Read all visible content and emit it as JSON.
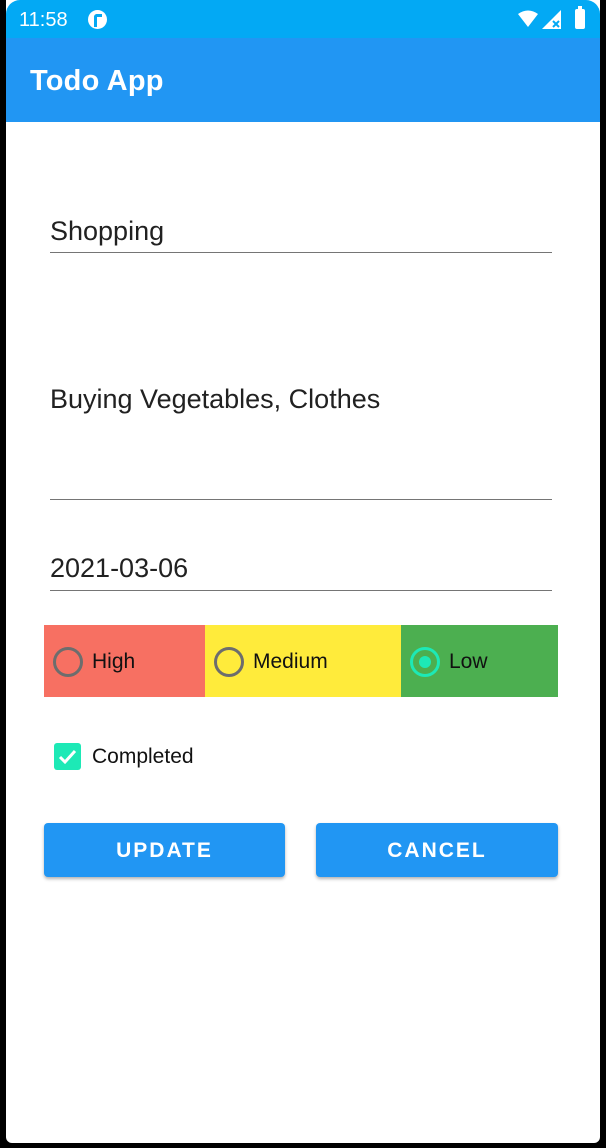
{
  "status_bar": {
    "time": "11:58",
    "icons": [
      "app-notification-icon",
      "wifi-icon",
      "signal-icon",
      "battery-icon"
    ]
  },
  "app_bar": {
    "title": "Todo App"
  },
  "form": {
    "title_value": "Shopping",
    "description_value": "Buying Vegetables, Clothes",
    "date_value": "2021-03-06",
    "priority": {
      "options": [
        {
          "label": "High",
          "color": "#f77062",
          "selected": false
        },
        {
          "label": "Medium",
          "color": "#ffeb3b",
          "selected": false
        },
        {
          "label": "Low",
          "color": "#4caf50",
          "selected": true
        }
      ]
    },
    "completed": {
      "label": "Completed",
      "checked": true
    },
    "buttons": {
      "update_label": "UPDATE",
      "cancel_label": "CANCEL"
    }
  },
  "colors": {
    "status_bar": "#03a9f4",
    "app_bar": "#2196f3",
    "accent": "#1de9b6",
    "button": "#2196f3"
  }
}
